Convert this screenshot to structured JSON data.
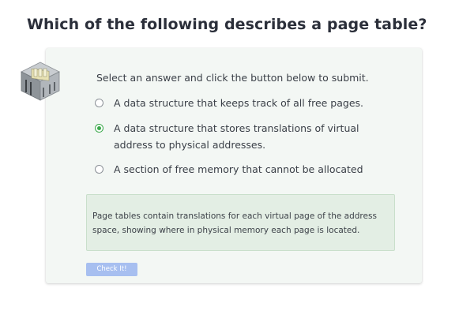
{
  "question": {
    "title": "Which of the following describes a page table?"
  },
  "quiz": {
    "icon": "server-rack-icon",
    "instructions": "Select an answer and click the button below to submit.",
    "options": [
      {
        "label": "A data structure that keeps track of all free pages.",
        "selected": false
      },
      {
        "label": "A data structure that stores translations of virtual address to physical addresses.",
        "selected": true
      },
      {
        "label": "A section of free memory that cannot be allocated",
        "selected": false
      }
    ],
    "feedback": "Page tables contain translations for each virtual page of the address space, showing where in physical memory each page is located.",
    "check_button_label": "Check It!"
  },
  "colors": {
    "card_background": "#f3f7f4",
    "feedback_background": "#e3eee4",
    "selected_accent": "#3aa84a",
    "button_background": "#a7bff0"
  }
}
